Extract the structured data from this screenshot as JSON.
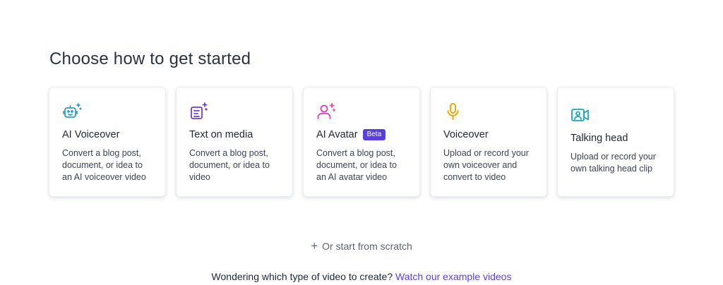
{
  "page": {
    "title": "Choose how to get started"
  },
  "cards": [
    {
      "icon": "robot-sparkle-icon",
      "title": "AI Voiceover",
      "badge": "",
      "description": "Convert a blog post, document, or idea to an AI voiceover video",
      "color": "#2a9fc7"
    },
    {
      "icon": "document-sparkle-icon",
      "title": "Text on media",
      "badge": "",
      "description": "Convert a blog post, document, or idea to video",
      "color": "#6c3fe0"
    },
    {
      "icon": "person-sparkle-icon",
      "title": "AI Avatar",
      "badge": "Beta",
      "description": "Convert a blog post, document, or idea to an AI avatar video",
      "color": "#e03fb8"
    },
    {
      "icon": "microphone-icon",
      "title": "Voiceover",
      "badge": "",
      "description": "Upload or record your own voiceover and convert to video",
      "color": "#f0a500"
    },
    {
      "icon": "video-camera-person-icon",
      "title": "Talking head",
      "badge": "",
      "description": "Upload or record your own talking head clip",
      "color": "#1aa6b7"
    }
  ],
  "scratch": {
    "icon": "plus-icon",
    "label": "Or start from scratch"
  },
  "footer": {
    "text": "Wondering which type of video to create?",
    "link": "Watch our example videos"
  },
  "colors": {
    "accent": "#5a3fe0",
    "badge_bg": "#5a3fe0"
  }
}
